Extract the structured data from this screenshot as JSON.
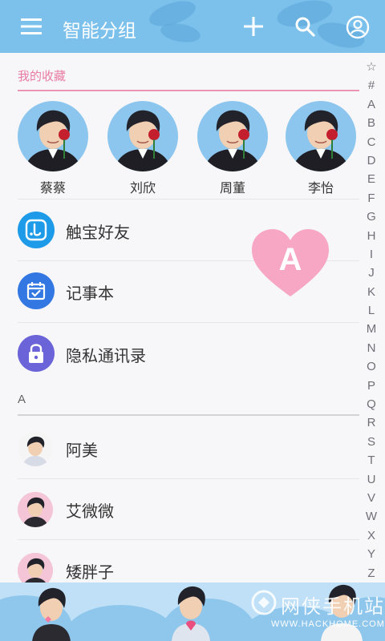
{
  "header": {
    "title": "智能分组"
  },
  "favorites": {
    "heading": "我的收藏",
    "items": [
      {
        "name": "蔡蔡"
      },
      {
        "name": "刘欣"
      },
      {
        "name": "周董"
      },
      {
        "name": "李怡"
      }
    ]
  },
  "quick_items": [
    {
      "label": "触宝好友",
      "icon": "touchpal-icon",
      "color": "#1e9be8"
    },
    {
      "label": "记事本",
      "icon": "calendar-check-icon",
      "color": "#3377e3"
    },
    {
      "label": "隐私通讯录",
      "icon": "lock-icon",
      "color": "#6b63d8"
    }
  ],
  "section": {
    "letter": "A",
    "heart_letter": "A"
  },
  "contacts": [
    {
      "name": "阿美"
    },
    {
      "name": "艾微微"
    },
    {
      "name": "矮胖子"
    }
  ],
  "index_letters": [
    "☆",
    "#",
    "A",
    "B",
    "C",
    "D",
    "E",
    "F",
    "G",
    "H",
    "I",
    "J",
    "K",
    "L",
    "M",
    "N",
    "O",
    "P",
    "Q",
    "R",
    "S",
    "T",
    "U",
    "V",
    "W",
    "X",
    "Y",
    "Z"
  ],
  "watermark": {
    "text": "网侠手机站",
    "url": "WWW.HACKHOME.COM"
  },
  "colors": {
    "topbar": "#7cc0ec",
    "accent_pink": "#ec94b4",
    "heart": "#f7a6c4"
  }
}
